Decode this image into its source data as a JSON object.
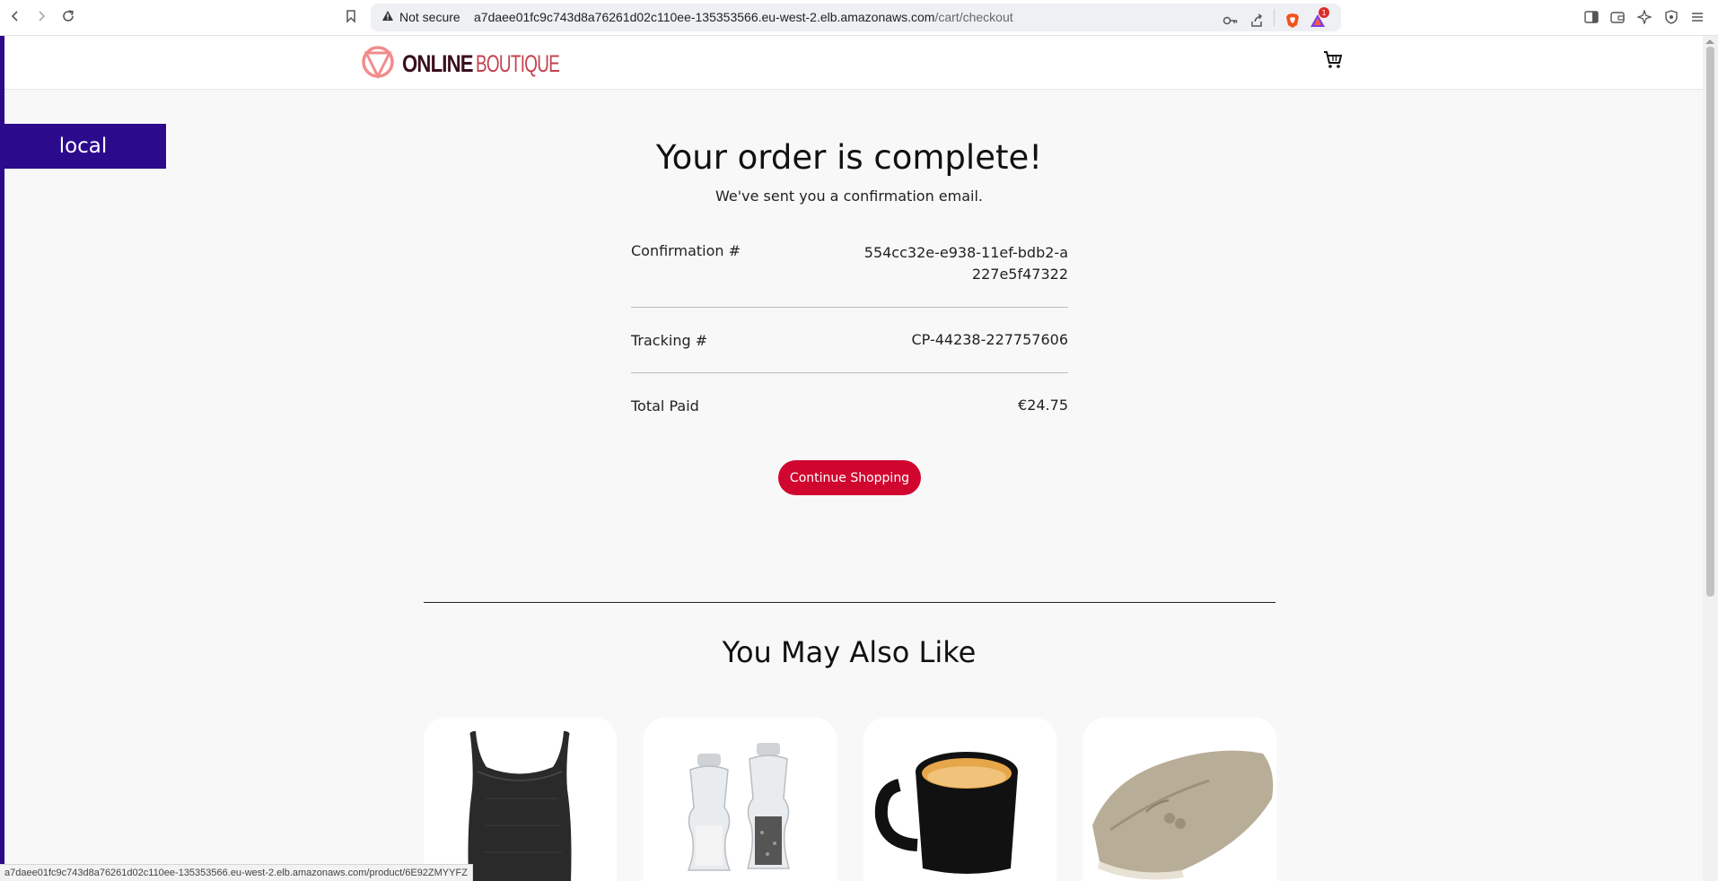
{
  "browser": {
    "security_label": "Not secure",
    "url_host": "a7daee01fc9c743d8a76261d02c110ee-135353566.eu-west-2.elb.amazonaws.com",
    "url_path": "/cart/checkout",
    "status_url": "a7daee01fc9c743d8a76261d02c110ee-135353566.eu-west-2.elb.amazonaws.com/product/6E92ZMYYFZ",
    "notification_count": "1",
    "icons": [
      "back-icon",
      "forward-icon",
      "reload-icon",
      "bookmark-icon",
      "warning-icon",
      "key-icon",
      "share-icon",
      "brave-shield-icon",
      "rewards-icon",
      "sidebar-icon",
      "wallet-icon",
      "leo-icon",
      "vpn-icon",
      "menu-icon"
    ]
  },
  "site": {
    "logo_bold": "ONLINE",
    "logo_thin": "BOUTIQUE",
    "env_badge": "local",
    "brand_color": "#d1062f",
    "badge_color": "#2b0a8c"
  },
  "order": {
    "title": "Your order is complete!",
    "subtitle": "We've sent you a confirmation email.",
    "rows": [
      {
        "label": "Confirmation #",
        "value": "554cc32e-e938-11ef-bdb2-a227e5f47322"
      },
      {
        "label": "Tracking #",
        "value": "CP-44238-227757606"
      },
      {
        "label": "Total Paid",
        "value": "€24.75"
      }
    ],
    "continue_label": "Continue Shopping"
  },
  "recommendations": {
    "heading": "You May Also Like",
    "items": [
      {
        "image": "tank-top"
      },
      {
        "image": "salt-and-pepper-shakers"
      },
      {
        "image": "mug"
      },
      {
        "image": "loafers"
      }
    ]
  }
}
